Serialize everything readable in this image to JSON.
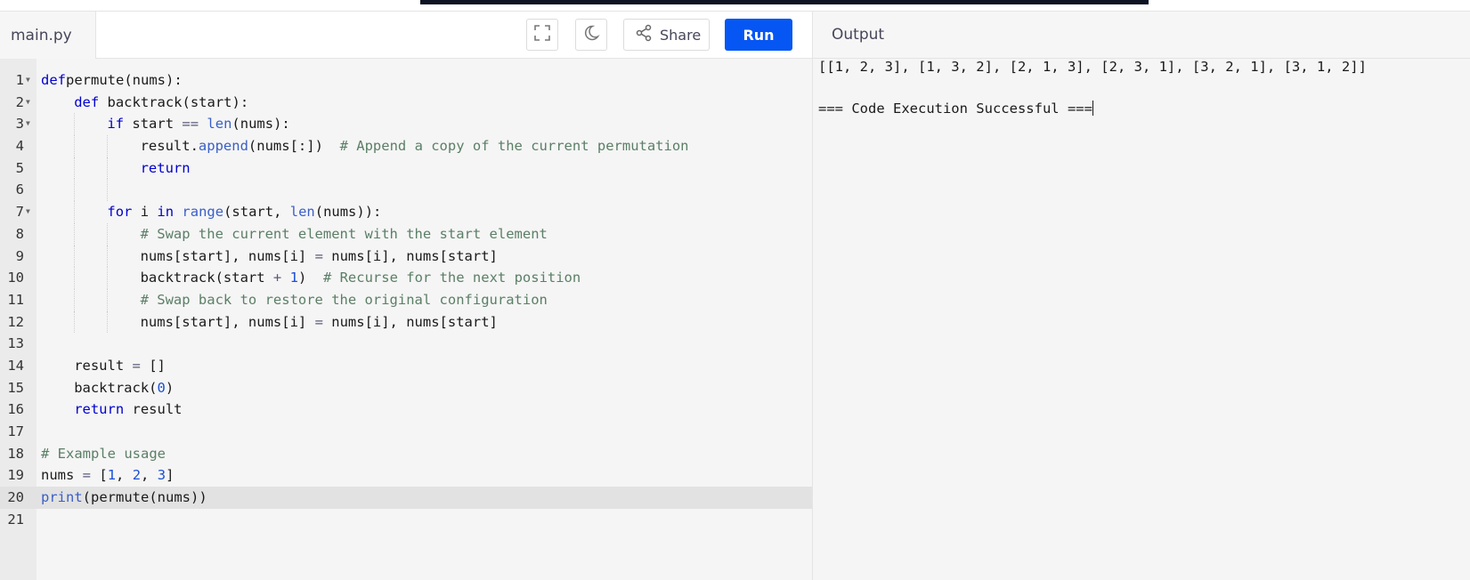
{
  "editor": {
    "filename": "main.py",
    "share_label": "Share",
    "run_label": "Run",
    "icons": {
      "fullscreen": "fullscreen-icon",
      "theme": "moon-icon",
      "share": "share-icon"
    },
    "active_line": 20,
    "lines": [
      {
        "n": "1",
        "fold": true,
        "indent": 0,
        "tokens": [
          [
            "kw",
            "def"
          ],
          [
            "",
            "permute(nums):"
          ]
        ]
      },
      {
        "n": "2",
        "fold": true,
        "indent": 1,
        "tokens": [
          [
            "kw",
            "def"
          ],
          [
            "",
            " backtrack(start):"
          ]
        ]
      },
      {
        "n": "3",
        "fold": true,
        "indent": 2,
        "tokens": [
          [
            "kw",
            "if"
          ],
          [
            "",
            " start "
          ],
          [
            "op",
            "=="
          ],
          [
            "",
            " "
          ],
          [
            "bi",
            "len"
          ],
          [
            "",
            "(nums):"
          ]
        ]
      },
      {
        "n": "4",
        "fold": false,
        "indent": 3,
        "tokens": [
          [
            "",
            "result."
          ],
          [
            "bi",
            "append"
          ],
          [
            "",
            "(nums[:])  "
          ],
          [
            "cm",
            "# Append a copy of the current permutation"
          ]
        ]
      },
      {
        "n": "5",
        "fold": false,
        "indent": 3,
        "tokens": [
          [
            "kw",
            "return"
          ]
        ]
      },
      {
        "n": "6",
        "fold": false,
        "indent": 0,
        "guides": 2,
        "tokens": []
      },
      {
        "n": "7",
        "fold": true,
        "indent": 2,
        "tokens": [
          [
            "kw",
            "for"
          ],
          [
            "",
            " i "
          ],
          [
            "kw",
            "in"
          ],
          [
            "",
            " "
          ],
          [
            "bi",
            "range"
          ],
          [
            "",
            "(start, "
          ],
          [
            "bi",
            "len"
          ],
          [
            "",
            "(nums)):"
          ]
        ]
      },
      {
        "n": "8",
        "fold": false,
        "indent": 3,
        "tokens": [
          [
            "cm",
            "# Swap the current element with the start element"
          ]
        ]
      },
      {
        "n": "9",
        "fold": false,
        "indent": 3,
        "tokens": [
          [
            "",
            "nums[start], nums[i] "
          ],
          [
            "op",
            "="
          ],
          [
            "",
            " nums[i], nums[start]"
          ]
        ]
      },
      {
        "n": "10",
        "fold": false,
        "indent": 3,
        "tokens": [
          [
            "",
            "backtrack(start "
          ],
          [
            "op",
            "+"
          ],
          [
            "",
            " "
          ],
          [
            "num",
            "1"
          ],
          [
            "",
            ")  "
          ],
          [
            "cm",
            "# Recurse for the next position"
          ]
        ]
      },
      {
        "n": "11",
        "fold": false,
        "indent": 3,
        "tokens": [
          [
            "cm",
            "# Swap back to restore the original configuration"
          ]
        ]
      },
      {
        "n": "12",
        "fold": false,
        "indent": 3,
        "tokens": [
          [
            "",
            "nums[start], nums[i] "
          ],
          [
            "op",
            "="
          ],
          [
            "",
            " nums[i], nums[start]"
          ]
        ]
      },
      {
        "n": "13",
        "fold": false,
        "indent": 0,
        "tokens": []
      },
      {
        "n": "14",
        "fold": false,
        "indent": 1,
        "tokens": [
          [
            "",
            "result "
          ],
          [
            "op",
            "="
          ],
          [
            "",
            " []"
          ]
        ]
      },
      {
        "n": "15",
        "fold": false,
        "indent": 1,
        "tokens": [
          [
            "",
            "backtrack("
          ],
          [
            "num",
            "0"
          ],
          [
            "",
            ")"
          ]
        ]
      },
      {
        "n": "16",
        "fold": false,
        "indent": 1,
        "tokens": [
          [
            "kw",
            "return"
          ],
          [
            "",
            " result"
          ]
        ]
      },
      {
        "n": "17",
        "fold": false,
        "indent": 0,
        "tokens": []
      },
      {
        "n": "18",
        "fold": false,
        "indent": 0,
        "tokens": [
          [
            "cm",
            "# Example usage"
          ]
        ]
      },
      {
        "n": "19",
        "fold": false,
        "indent": 0,
        "tokens": [
          [
            "",
            "nums "
          ],
          [
            "op",
            "="
          ],
          [
            "",
            " ["
          ],
          [
            "num",
            "1"
          ],
          [
            "",
            ", "
          ],
          [
            "num",
            "2"
          ],
          [
            "",
            ", "
          ],
          [
            "num",
            "3"
          ],
          [
            "",
            "]"
          ]
        ]
      },
      {
        "n": "20",
        "fold": false,
        "indent": 0,
        "tokens": [
          [
            "bi",
            "print"
          ],
          [
            "",
            "(permute(nums))"
          ]
        ]
      },
      {
        "n": "21",
        "fold": false,
        "indent": 0,
        "tokens": []
      }
    ]
  },
  "output": {
    "title": "Output",
    "result_line": "[[1, 2, 3], [1, 3, 2], [2, 1, 3], [2, 3, 1], [3, 2, 1], [3, 1, 2]]",
    "status_line": "=== Code Execution Successful ==="
  },
  "colors": {
    "run_button": "#0556f3",
    "keyword": "#0000cf",
    "comment": "#5b7f66",
    "number": "#1a4fd6"
  }
}
